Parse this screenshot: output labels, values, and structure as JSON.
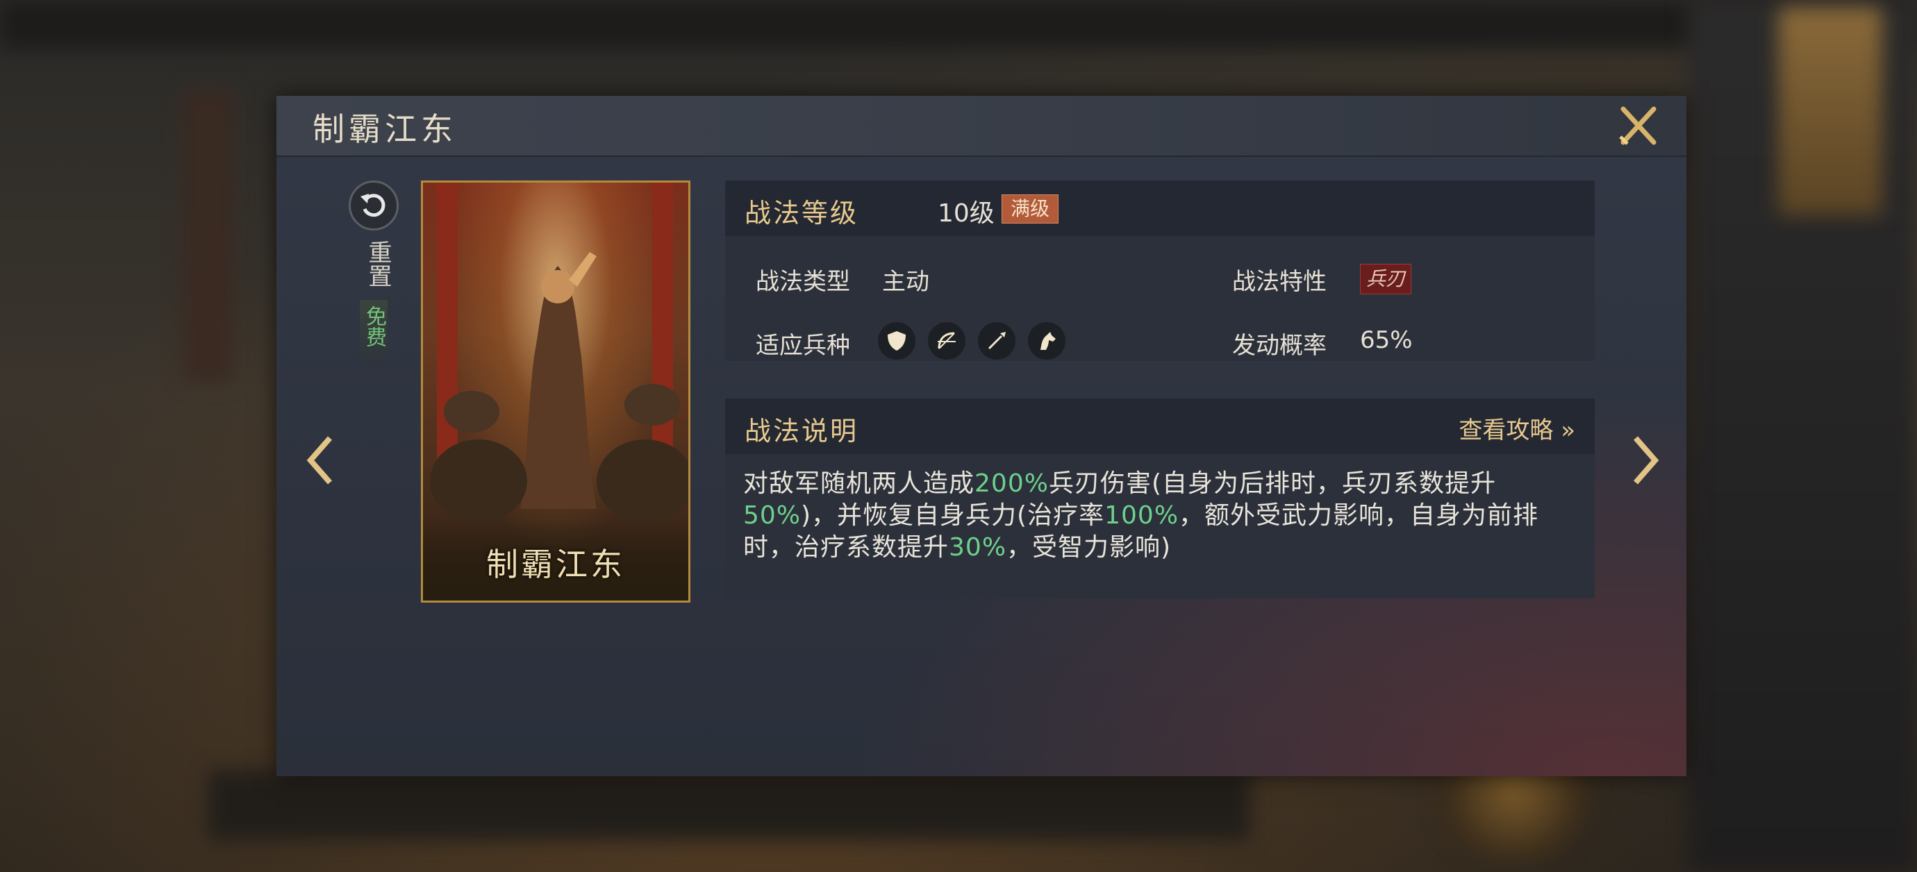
{
  "title": "制霸江东",
  "reset": {
    "label": "重置",
    "cost": "免费"
  },
  "card": {
    "name": "制霸江东"
  },
  "level": {
    "label": "战法等级",
    "value": "10级",
    "badge": "满级"
  },
  "attributes": {
    "type_label": "战法类型",
    "type_value": "主动",
    "trait_label": "战法特性",
    "trait_value": "兵刃",
    "troops_label": "适应兵种",
    "troops": [
      "shield-icon",
      "bow-icon",
      "spear-icon",
      "horse-icon"
    ],
    "chance_label": "发动概率",
    "chance_value": "65%"
  },
  "description": {
    "heading": "战法说明",
    "guide_link": "查看攻略 »",
    "seg1": "对敌军随机两人造成",
    "hl1": "200%",
    "seg2": "兵刃伤害(自身为后排时，兵刃系数提升",
    "hl2": "50%",
    "seg3": ")，并恢复自身兵力(治疗率",
    "hl3": "100%",
    "seg4": "，额外受武力影响，自身为前排时，治疗系数提升",
    "hl4": "30%",
    "seg5": "，受智力影响)"
  },
  "colors": {
    "highlight": "#6fd08c",
    "gold": "#e7c98d",
    "badge": "#b25a3a"
  }
}
